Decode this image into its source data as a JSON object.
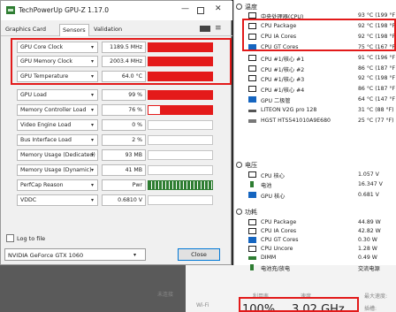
{
  "gpuz": {
    "title": "TechPowerUp GPU-Z 1.17.0",
    "window_controls": {
      "minimize": "—",
      "close": "✕"
    },
    "tabs": [
      "Graphics Card",
      "Sensors",
      "Validation"
    ],
    "menu_icon": "≡",
    "dropdown_glyph": "▾",
    "sensors": [
      {
        "name": "GPU Core Clock",
        "value": "1189.5 MHz",
        "graph": "red"
      },
      {
        "name": "GPU Memory Clock",
        "value": "2003.4 MHz",
        "graph": "red"
      },
      {
        "name": "GPU Temperature",
        "value": "64.0 °C",
        "graph": "red"
      },
      {
        "name": "GPU Load",
        "value": "99 %",
        "graph": "red"
      },
      {
        "name": "Memory Controller Load",
        "value": "76 %",
        "graph": "partial"
      },
      {
        "name": "Video Engine Load",
        "value": "0 %",
        "graph": "empty"
      },
      {
        "name": "Bus Interface Load",
        "value": "2 %",
        "graph": "empty"
      },
      {
        "name": "Memory Usage (Dedicated)",
        "value": "93 MB",
        "graph": "empty"
      },
      {
        "name": "Memory Usage (Dynamic)",
        "value": "41 MB",
        "graph": "empty"
      },
      {
        "name": "PerfCap Reason",
        "value": "Pwr",
        "graph": "bars"
      },
      {
        "name": "VDDC",
        "value": "0.6810 V",
        "graph": "empty"
      }
    ],
    "log_to_file_label": "Log to file",
    "gpu_select_value": "NVIDIA GeForce GTX 1060",
    "close_label": "Close"
  },
  "hw": {
    "temps_title": "温度",
    "temps": [
      {
        "icon": "chip",
        "name": "中央处理器(CPU)",
        "value": "93 °C  (199 °F"
      },
      {
        "icon": "chip",
        "name": "CPU Package",
        "value": "92 °C  (198 °F"
      },
      {
        "icon": "chip",
        "name": "CPU IA Cores",
        "value": "92 °C  (198 °F"
      },
      {
        "icon": "gpuc",
        "name": "CPU GT Cores",
        "value": "75 °C  (167 °F"
      },
      {
        "icon": "chip",
        "name": "CPU #1/核心 #1",
        "value": "91 °C  (196 °F"
      },
      {
        "icon": "chip",
        "name": "CPU #1/核心 #2",
        "value": "86 °C  (187 °F"
      },
      {
        "icon": "chip",
        "name": "CPU #1/核心 #3",
        "value": "92 °C  (198 °F"
      },
      {
        "icon": "chip",
        "name": "CPU #1/核心 #4",
        "value": "86 °C  (187 °F"
      },
      {
        "icon": "gpuc",
        "name": "GPU 二极管",
        "value": "64 °C  (147 °F"
      },
      {
        "icon": "ssd",
        "name": "LITEON V2G pro  128",
        "value": "31 °C  (88 °F)"
      },
      {
        "icon": "hdd",
        "name": "HGST HTS541010A9E680",
        "value": "25 °C  (77 °F)"
      }
    ],
    "volt_title": "电压",
    "volts": [
      {
        "icon": "chip",
        "name": "CPU 核心",
        "value": "1.057 V"
      },
      {
        "icon": "batt",
        "name": "电池",
        "value": "16.347 V"
      },
      {
        "icon": "gpuc",
        "name": "GPU 核心",
        "value": "0.681 V"
      }
    ],
    "power_title": "功耗",
    "powers": [
      {
        "icon": "chip",
        "name": "CPU Package",
        "value": "44.89 W"
      },
      {
        "icon": "chip",
        "name": "CPU IA Cores",
        "value": "42.82 W"
      },
      {
        "icon": "gpuc",
        "name": "CPU GT Cores",
        "value": "0.30 W"
      },
      {
        "icon": "chip",
        "name": "CPU Uncore",
        "value": "1.28 W"
      },
      {
        "icon": "dimm",
        "name": "DIMM",
        "value": "0.49 W"
      },
      {
        "icon": "plug",
        "name": "电池充/放电",
        "value": "交流电源"
      }
    ]
  },
  "backdrop": {
    "tiny1": "未连接",
    "util_label": "利用率",
    "speed_label": "速度",
    "max_speed_label": "最大速度:",
    "util_value": "100%",
    "speed_value": "3.02 GHz",
    "tiny2": "插槽:",
    "wifi_label": "Wi-Fi"
  },
  "colors": {
    "highlight": "#e21a1a",
    "graph_red": "#e41a1a",
    "graph_green": "#2e7d32"
  }
}
